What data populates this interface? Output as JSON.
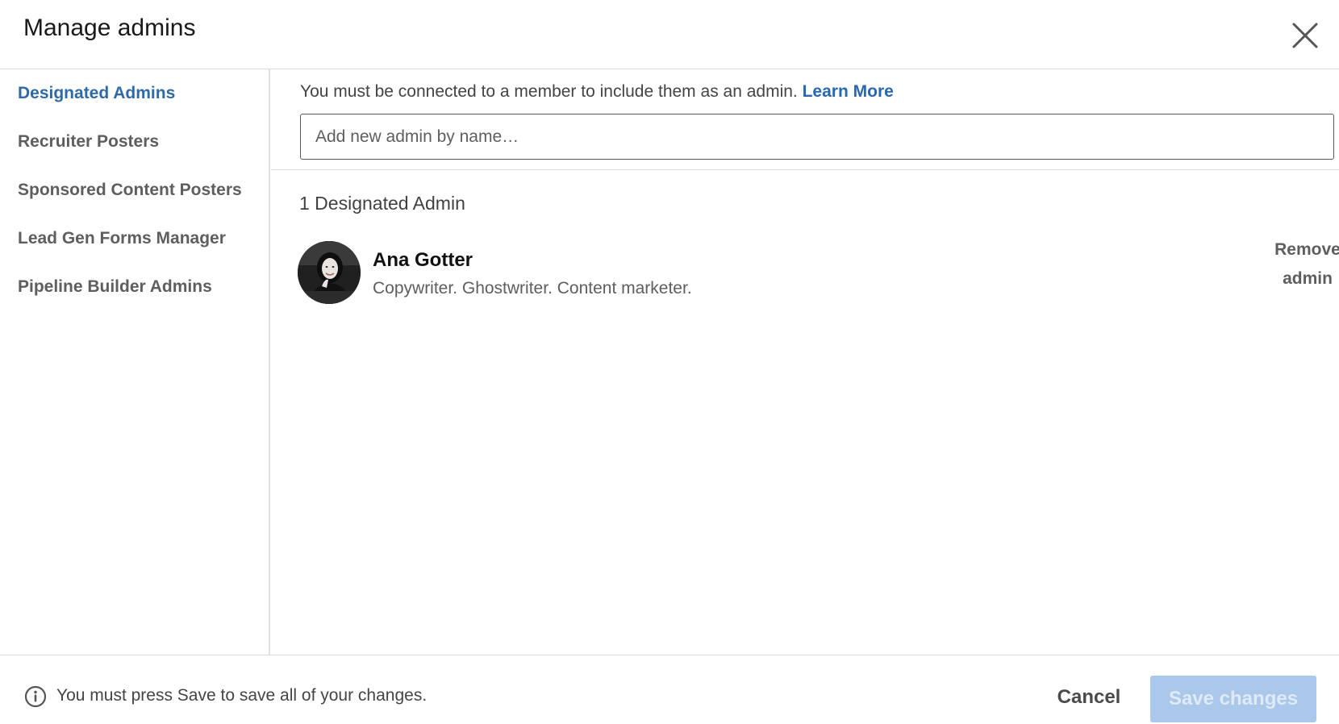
{
  "modal": {
    "title": "Manage admins"
  },
  "sidebar": {
    "items": [
      {
        "label": "Designated Admins",
        "active": true
      },
      {
        "label": "Recruiter Posters",
        "active": false
      },
      {
        "label": "Sponsored Content Posters",
        "active": false
      },
      {
        "label": "Lead Gen Forms Manager",
        "active": false
      },
      {
        "label": "Pipeline Builder Admins",
        "active": false
      }
    ]
  },
  "main": {
    "notice_text": "You must be connected to a member to include them as an admin.",
    "learn_more_label": "Learn More",
    "search_placeholder": "Add new admin by name…",
    "count_label": "1 Designated Admin",
    "admins": [
      {
        "name": "Ana Gotter",
        "headline": "Copywriter. Ghostwriter. Content marketer.",
        "remove_label_line1": "Remove",
        "remove_label_line2": "admin"
      }
    ]
  },
  "footer": {
    "info_text": "You must press Save to save all of your changes.",
    "cancel_label": "Cancel",
    "save_label": "Save changes"
  },
  "colors": {
    "accent": "#2867b2",
    "active_nav": "#2f6aa8",
    "save_disabled_bg": "#a9c8ea"
  }
}
